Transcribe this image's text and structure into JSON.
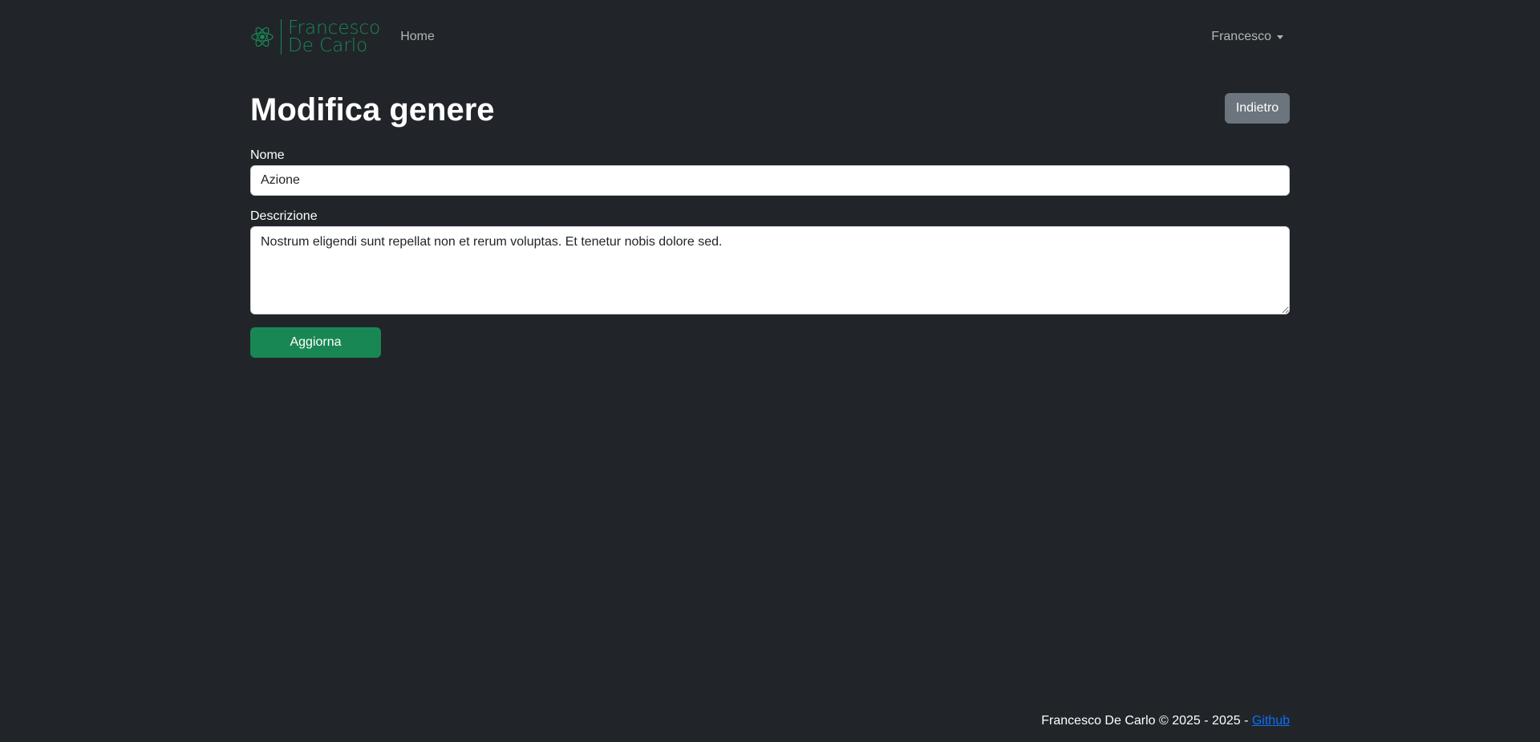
{
  "navbar": {
    "brand_line1": "Francesco",
    "brand_line2": "De Carlo",
    "brand_icon": "atom-logo-icon",
    "home_label": "Home",
    "user_label": "Francesco"
  },
  "page": {
    "title": "Modifica genere",
    "back_label": "Indietro"
  },
  "form": {
    "nome_label": "Nome",
    "nome_value": "Azione",
    "descrizione_label": "Descrizione",
    "descrizione_value": "Nostrum eligendi sunt repellat non et rerum voluptas. Et tenetur nobis dolore sed.",
    "submit_label": "Aggiorna"
  },
  "footer": {
    "text": "Francesco De Carlo © 2025 - 2025 - ",
    "link_label": "Github"
  },
  "colors": {
    "background": "#212529",
    "brand_green": "#198754",
    "secondary_button": "#6c757d",
    "link_blue": "#0d6efd"
  }
}
